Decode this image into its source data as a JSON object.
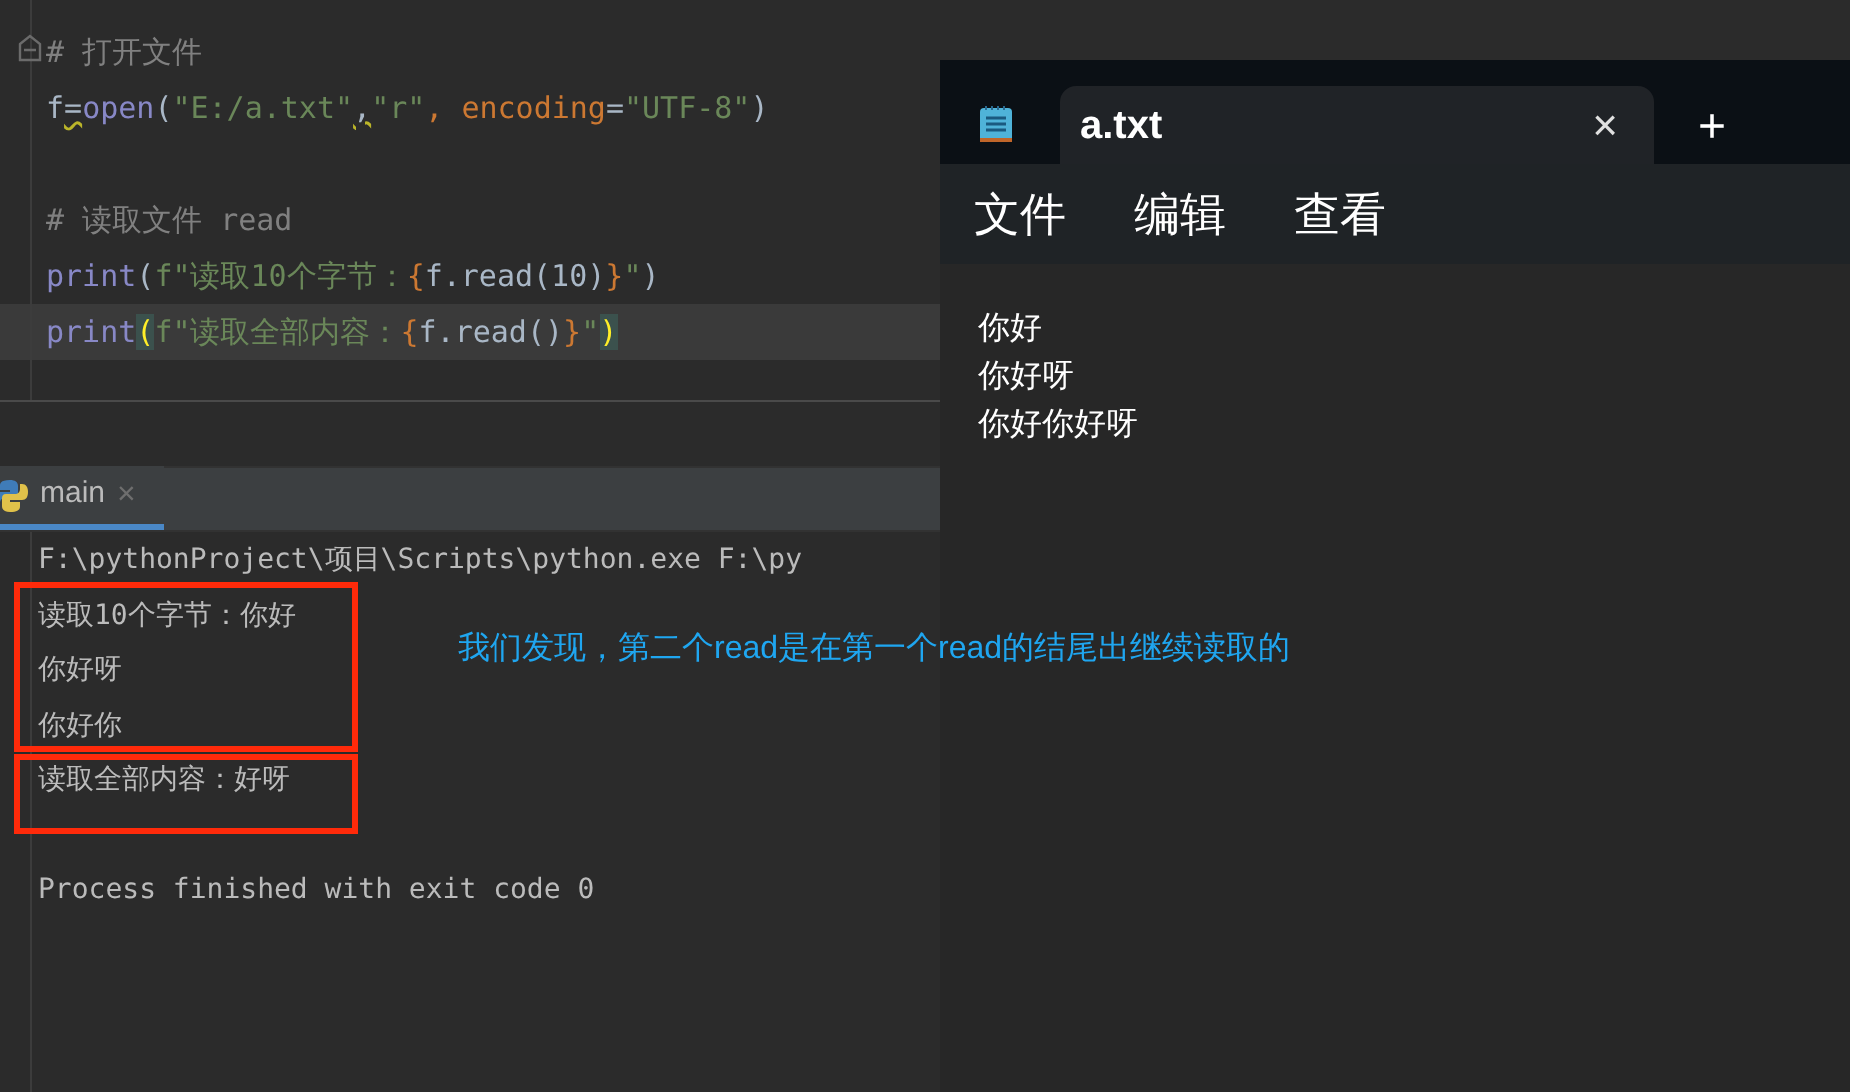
{
  "editor": {
    "lines": [
      {
        "current": false,
        "tokens": [
          {
            "text": "# 打开文件",
            "kind": "comment"
          }
        ]
      },
      {
        "current": false,
        "tokens": [
          {
            "text": "f",
            "kind": "name"
          },
          {
            "text": "=",
            "kind": "warn"
          },
          {
            "text": "open",
            "kind": "builtin"
          },
          {
            "text": "(",
            "kind": "punct"
          },
          {
            "text": "\"E:/a.txt\"",
            "kind": "string"
          },
          {
            "text": ",",
            "kind": "warn"
          },
          {
            "text": "\"r\"",
            "kind": "string"
          },
          {
            "text": ", ",
            "kind": "keyword"
          },
          {
            "text": "encoding",
            "kind": "param"
          },
          {
            "text": "=",
            "kind": "punct"
          },
          {
            "text": "\"UTF-8\"",
            "kind": "string"
          },
          {
            "text": ")",
            "kind": "punct"
          }
        ]
      },
      {
        "current": false
      },
      {
        "current": false,
        "tokens": [
          {
            "text": "# 读取文件 read",
            "kind": "comment"
          }
        ]
      },
      {
        "current": false,
        "tokens": [
          {
            "text": "print",
            "kind": "builtin"
          },
          {
            "text": "(",
            "kind": "punct"
          },
          {
            "text": "f\"读取10个字节：",
            "kind": "string"
          },
          {
            "text": "{",
            "kind": "brace"
          },
          {
            "text": "f.read(10)",
            "kind": "name"
          },
          {
            "text": "}",
            "kind": "brace"
          },
          {
            "text": "\"",
            "kind": "string"
          },
          {
            "text": ")",
            "kind": "punct"
          }
        ]
      },
      {
        "current": true,
        "tokens": [
          {
            "text": "print",
            "kind": "builtin"
          },
          {
            "text": "(",
            "kind": "match"
          },
          {
            "text": "f\"读取全部内容：",
            "kind": "string"
          },
          {
            "text": "{",
            "kind": "brace"
          },
          {
            "text": "f.read()",
            "kind": "name"
          },
          {
            "text": "}",
            "kind": "brace"
          },
          {
            "text": "\"",
            "kind": "string"
          },
          {
            "text": ")",
            "kind": "match"
          }
        ]
      }
    ]
  },
  "run_tab": {
    "label": "main",
    "close": "×"
  },
  "console": {
    "lines": [
      {
        "text": "F:\\pythonProject\\项目\\Scripts\\python.exe F:\\py"
      },
      {
        "text": "读取10个字节：你好"
      },
      {
        "text": "你好呀"
      },
      {
        "text": "你好你"
      },
      {
        "text": "读取全部内容：好呀"
      }
    ],
    "exit_message": "Process finished with exit code 0"
  },
  "annotation": "我们发现，第二个read是在第一个read的结尾出继续读取的",
  "notepad": {
    "tab_title": "a.txt",
    "close": "×",
    "new_tab": "+",
    "menu": [
      "文件",
      "编辑",
      "查看"
    ],
    "content": [
      "你好",
      "你好呀",
      "你好你好呀"
    ]
  }
}
